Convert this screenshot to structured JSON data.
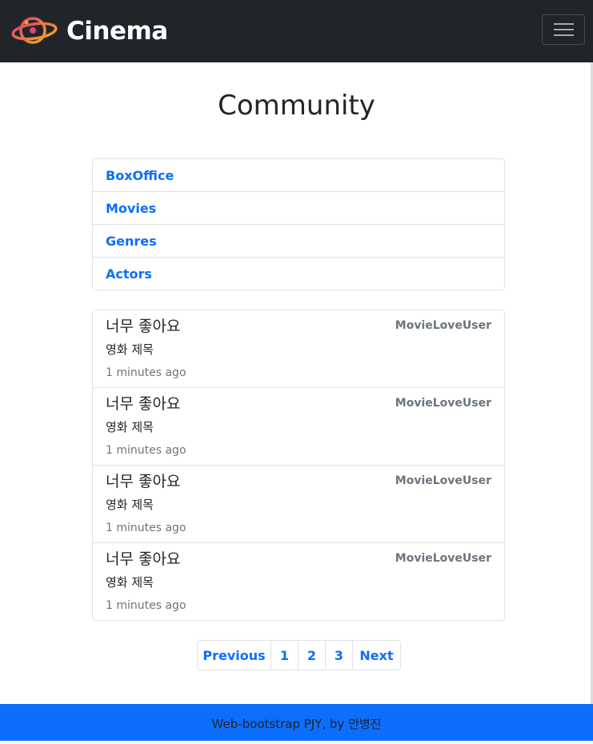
{
  "navbar": {
    "brand": "Cinema",
    "logo_icon": "planet-logo-icon",
    "toggle_icon": "hamburger-menu-icon"
  },
  "page": {
    "title": "Community"
  },
  "menu": {
    "items": [
      {
        "label": "BoxOffice"
      },
      {
        "label": "Movies"
      },
      {
        "label": "Genres"
      },
      {
        "label": "Actors"
      }
    ]
  },
  "reviews": [
    {
      "title": "너무 좋아요",
      "movie": "영화 제목",
      "time": "1 minutes ago",
      "user": "MovieLoveUser"
    },
    {
      "title": "너무 좋아요",
      "movie": "영화 제목",
      "time": "1 minutes ago",
      "user": "MovieLoveUser"
    },
    {
      "title": "너무 좋아요",
      "movie": "영화 제목",
      "time": "1 minutes ago",
      "user": "MovieLoveUser"
    },
    {
      "title": "너무 좋아요",
      "movie": "영화 제목",
      "time": "1 minutes ago",
      "user": "MovieLoveUser"
    }
  ],
  "pagination": {
    "previous": "Previous",
    "pages": [
      "1",
      "2",
      "3"
    ],
    "next": "Next"
  },
  "footer": {
    "text": "Web-bootstrap PJY, by 안병진"
  },
  "colors": {
    "navbar_bg": "#212529",
    "link": "#0d6efd",
    "footer_bg": "#0d6efd",
    "muted": "#6c757d",
    "border": "#dee2e6"
  }
}
